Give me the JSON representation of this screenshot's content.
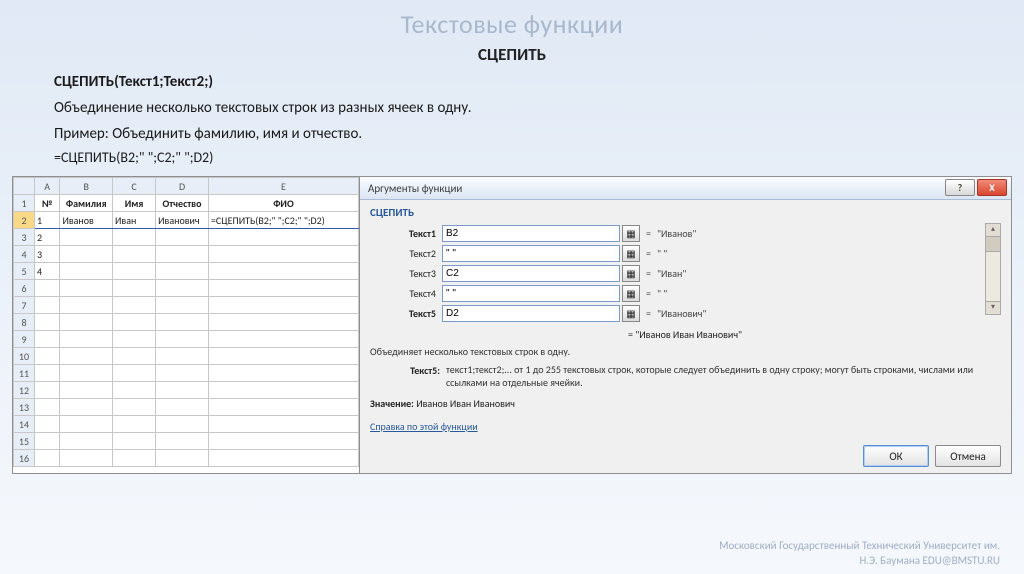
{
  "slide": {
    "title": "Текстовые функции",
    "subtitle": "СЦЕПИТЬ",
    "syntax": "СЦЕПИТЬ(Текст1;Текст2;)",
    "description": "Объединение несколько текстовых строк из разных ячеек в одну.",
    "example": "Пример: Объединить фамилию, имя и отчество.",
    "formula": "=СЦЕПИТЬ(B2;\" \";C2;\"  \";D2)"
  },
  "sheet": {
    "cols": [
      "A",
      "B",
      "C",
      "D",
      "E"
    ],
    "headers": {
      "A": "№",
      "B": "Фамилия",
      "C": "Имя",
      "D": "Отчество",
      "E": "ФИО"
    },
    "rows": [
      {
        "n": "1",
        "A": "1",
        "B": "Иванов",
        "C": "Иван",
        "D": "Иванович",
        "E": "=СЦЕПИТЬ(B2;\" \";C2;\"  \";D2)"
      },
      {
        "n": "2",
        "A": "2"
      },
      {
        "n": "3",
        "A": "3"
      },
      {
        "n": "4",
        "A": "4"
      }
    ]
  },
  "dlg": {
    "title": "Аргументы функции",
    "fn": "СЦЕПИТЬ",
    "args": [
      {
        "label": "Текст1",
        "value": "B2",
        "result": "\"Иванов\"",
        "bold": true
      },
      {
        "label": "Текст2",
        "value": "\" \"",
        "result": "\" \"",
        "bold": false
      },
      {
        "label": "Текст3",
        "value": "C2",
        "result": "\"Иван\"",
        "bold": false
      },
      {
        "label": "Текст4",
        "value": "\" \"",
        "result": "\" \"",
        "bold": false
      },
      {
        "label": "Текст5",
        "value": "D2",
        "result": "\"Иванович\"",
        "bold": true
      }
    ],
    "combined": "= \"Иванов Иван  Иванович\"",
    "hint": "Объединяет несколько текстовых строк в одну.",
    "detail_key": "Текст5:",
    "detail_val": "текст1;текст2;... от 1 до 255 текстовых строк, которые следует объединить в одну строку; могут быть строками, числами или ссылками на отдельные ячейки.",
    "value_label": "Значение:",
    "value": "Иванов Иван  Иванович",
    "help": "Справка по этой функции",
    "ok": "ОК",
    "cancel": "Отмена",
    "help_icon": "?",
    "close_icon": "X"
  },
  "footer": {
    "l1": "Московский Государственный Технический Университет им.",
    "l2": "Н.Э. Баумана EDU@BMSTU.RU"
  }
}
